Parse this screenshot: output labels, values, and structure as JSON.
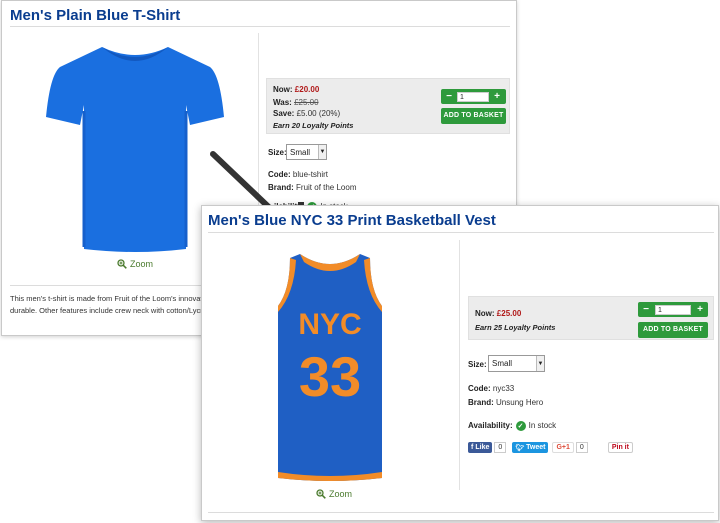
{
  "product1": {
    "title": "Men's Plain Blue T-Shirt",
    "zoom_label": "Zoom",
    "price_now_label": "Now:",
    "price_now_value": "£20.00",
    "price_was_label": "Was:",
    "price_was_value": "£25.00",
    "price_save_label": "Save:",
    "price_save_value": "£5.00 (20%)",
    "loyalty": "Earn 20 Loyalty Points",
    "qty_minus": "−",
    "qty_value": "1",
    "qty_plus": "+",
    "add_to_basket": "ADD TO BASKET",
    "size_label": "Size:",
    "size_selected": "Small",
    "code_label": "Code:",
    "code_value": "blue-tshirt",
    "brand_label": "Brand:",
    "brand_value": "Fruit of the Loom",
    "availability_partial": "ilability:",
    "stock_partial": "In stock",
    "description_line1": "This men's t-shirt is made from Fruit of the Loom's innovat",
    "description_line2": "durable. Other features include crew neck with cotton/Lycra"
  },
  "product2": {
    "title": "Men's Blue NYC 33 Print Basketball Vest",
    "zoom_label": "Zoom",
    "price_now_label": "Now:",
    "price_now_value": "£25.00",
    "loyalty": "Earn 25 Loyalty Points",
    "qty_minus": "−",
    "qty_value": "1",
    "qty_plus": "+",
    "add_to_basket": "ADD TO BASKET",
    "size_label": "Size:",
    "size_selected": "Small",
    "code_label": "Code:",
    "code_value": "nyc33",
    "brand_label": "Brand:",
    "brand_value": "Unsung Hero",
    "availability_label": "Availability:",
    "stock_value": "In stock",
    "vest_letters": "NYC",
    "vest_number": "33",
    "social": {
      "like_label": "Like",
      "like_count": "0",
      "tweet_label": "Tweet",
      "gplus_label": "G+1",
      "gplus_count": "0",
      "pin_label": "Pin it"
    }
  },
  "colors": {
    "title_blue": "#0a3d8f",
    "price_red": "#b01818",
    "button_green": "#2e9a3c",
    "tshirt_blue": "#1a6fe0",
    "vest_blue": "#1f5fc4",
    "vest_orange": "#f28c28"
  }
}
